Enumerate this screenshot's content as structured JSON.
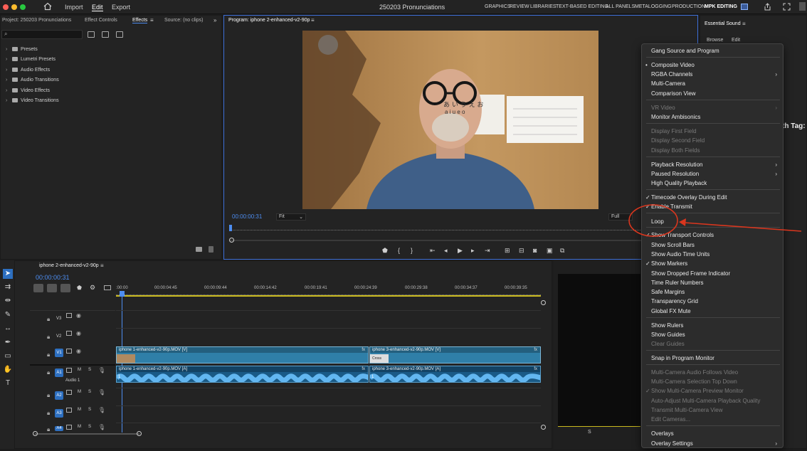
{
  "window": {
    "title": "250203 Pronunciations"
  },
  "nav": {
    "import": "Import",
    "edit": "Edit",
    "export": "Export"
  },
  "workspaces": [
    "GRAPHICS",
    "REVIEW",
    "LIBRARIES",
    "TEXT-BASED EDITING",
    "ALL PANELS",
    "METALOGGING",
    "PRODUCTION",
    "MPK EDITING"
  ],
  "project_panel": {
    "tabs": [
      "Project: 250203 Pronunciations",
      "Effect Controls",
      "Effects",
      "Source: (no clips)"
    ],
    "active_tab": "Effects",
    "tree": [
      "Presets",
      "Lumetri Presets",
      "Audio Effects",
      "Audio Transitions",
      "Video Effects",
      "Video Transitions"
    ]
  },
  "program": {
    "tab": "Program: iphone 2-enhanced-v2-90p",
    "timecode": "00:00:00:31",
    "zoom": "Fit",
    "resolution": "Full",
    "video": {
      "poster_kana": "あ い う え お",
      "poster_romaji": "a   i   u   e   o"
    }
  },
  "essential_sound": {
    "title": "Essential Sound",
    "tabs": [
      "Browse",
      "Edit"
    ],
    "partial_text": "th Tag:"
  },
  "timeline": {
    "tab": "iphone 2-enhanced-v2-90p",
    "timecode": "00:00:00:31",
    "ruler": [
      ":00:00",
      "00:00:04:45",
      "00:00:09:44",
      "00:00:14:42",
      "00:00:19:41",
      "00:00:24:39",
      "00:00:29:38",
      "00:00:34:37",
      "00:00:39:35"
    ],
    "tracks": {
      "v3": "V3",
      "v2": "V2",
      "v1": "V1",
      "a1": "A1",
      "a1_name": "Audio 1",
      "a2": "A2",
      "a3": "A3",
      "a4": "A4",
      "m": "M",
      "s": "S"
    },
    "clips": {
      "v1_a": "iphone 1-enhanced-v2-90p.MOV [V]",
      "v1_b": "iphone 3-enhanced-v2-90p.MOV [V]",
      "a1_a": "iphone 1-enhanced-v2-90p.MOV [A]",
      "a1_b": "iphone 3-enhanced-v2-90p.MOV [A]",
      "cross": "Cross",
      "channel": "1",
      "fx": "fx"
    },
    "right_label": "S"
  },
  "menu": {
    "items": [
      {
        "label": "Gang Source and Program",
        "state": "normal"
      },
      {
        "label": "Composite Video",
        "state": "bullet"
      },
      {
        "label": "RGBA Channels",
        "state": "submenu"
      },
      {
        "label": "Multi-Camera",
        "state": "normal"
      },
      {
        "label": "Comparison View",
        "state": "normal"
      },
      {
        "label": "VR Video",
        "state": "disabled-submenu"
      },
      {
        "label": "Monitor Ambisonics",
        "state": "normal"
      },
      {
        "label": "Display First Field",
        "state": "disabled"
      },
      {
        "label": "Display Second Field",
        "state": "disabled"
      },
      {
        "label": "Display Both Fields",
        "state": "disabled"
      },
      {
        "label": "Playback Resolution",
        "state": "submenu"
      },
      {
        "label": "Paused Resolution",
        "state": "submenu"
      },
      {
        "label": "High Quality Playback",
        "state": "normal"
      },
      {
        "label": "Timecode Overlay During Edit",
        "state": "checked"
      },
      {
        "label": "Enable Transmit",
        "state": "checked"
      },
      {
        "label": "Loop",
        "state": "normal"
      },
      {
        "label": "Show Transport Controls",
        "state": "checked"
      },
      {
        "label": "Show Scroll Bars",
        "state": "normal"
      },
      {
        "label": "Show Audio Time Units",
        "state": "normal"
      },
      {
        "label": "Show Markers",
        "state": "checked"
      },
      {
        "label": "Show Dropped Frame Indicator",
        "state": "normal"
      },
      {
        "label": "Time Ruler Numbers",
        "state": "normal"
      },
      {
        "label": "Safe Margins",
        "state": "normal"
      },
      {
        "label": "Transparency Grid",
        "state": "normal"
      },
      {
        "label": "Global FX Mute",
        "state": "normal"
      },
      {
        "label": "Show Rulers",
        "state": "normal"
      },
      {
        "label": "Show Guides",
        "state": "normal"
      },
      {
        "label": "Clear Guides",
        "state": "disabled"
      },
      {
        "label": "Snap in Program Monitor",
        "state": "normal"
      },
      {
        "label": "Multi-Camera Audio Follows Video",
        "state": "disabled"
      },
      {
        "label": "Multi-Camera Selection Top Down",
        "state": "disabled"
      },
      {
        "label": "Show Multi-Camera Preview Monitor",
        "state": "disabled-checked"
      },
      {
        "label": "Auto-Adjust Multi-Camera Playback Quality",
        "state": "disabled"
      },
      {
        "label": "Transmit Multi-Camera View",
        "state": "disabled"
      },
      {
        "label": "Edit Cameras...",
        "state": "disabled"
      },
      {
        "label": "Overlays",
        "state": "normal"
      },
      {
        "label": "Overlay Settings",
        "state": "submenu"
      }
    ]
  },
  "annotation_color": "#d9361e"
}
